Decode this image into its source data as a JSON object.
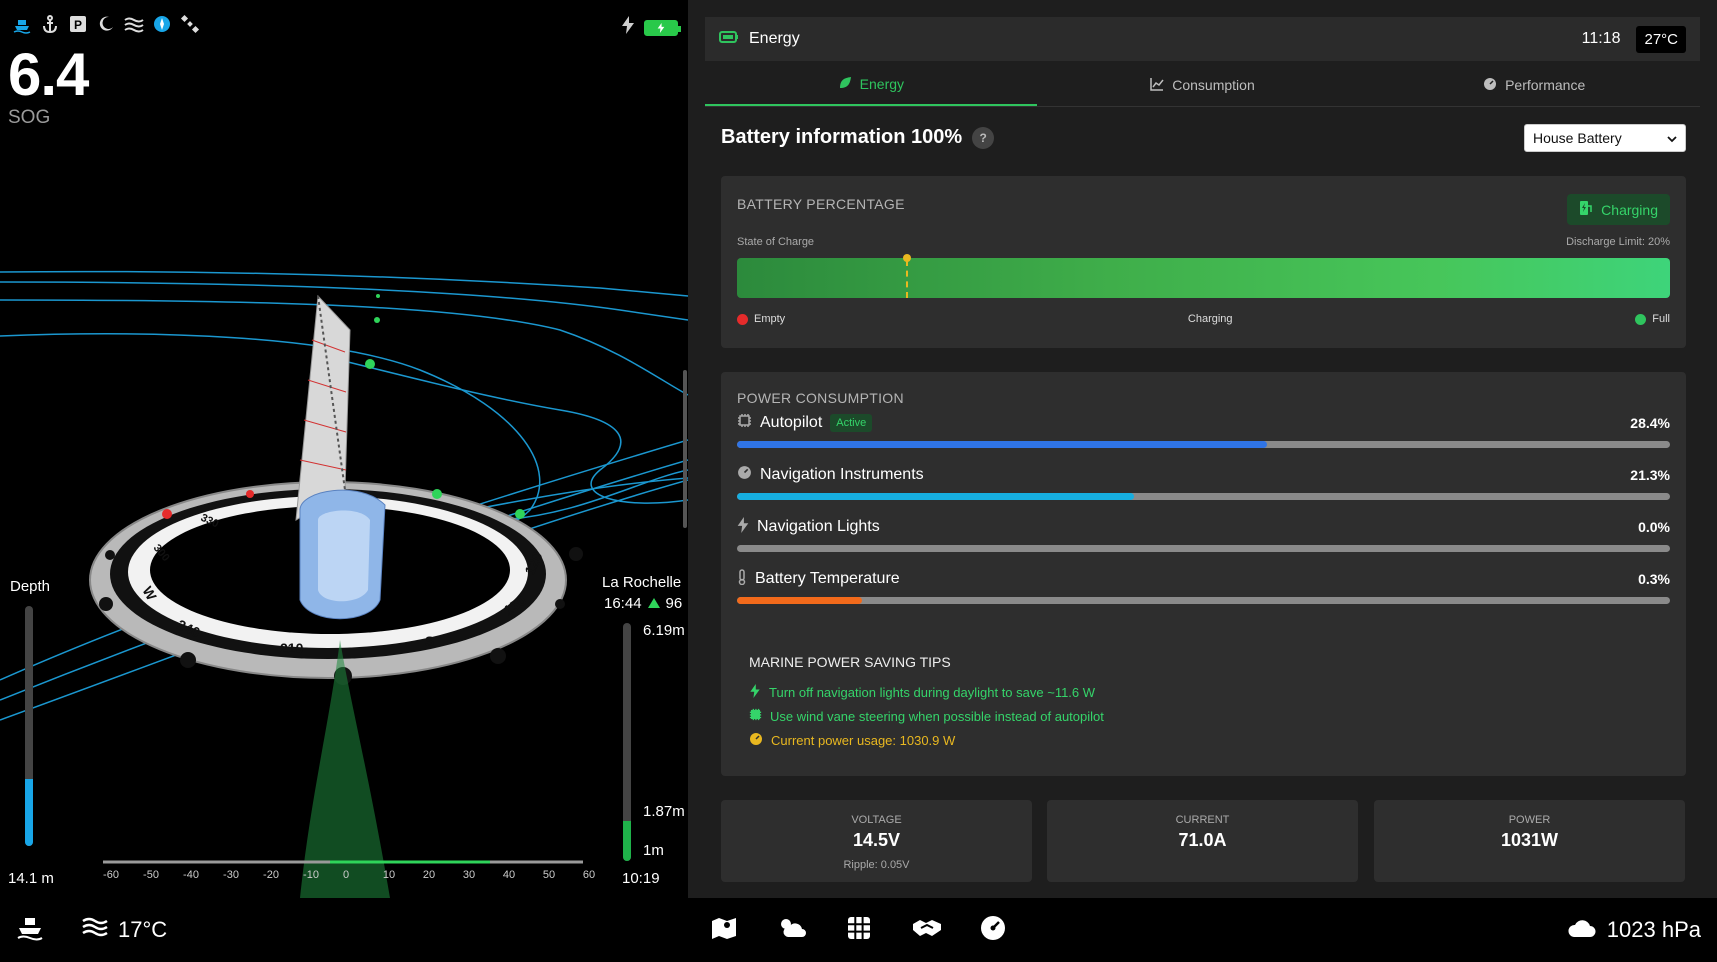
{
  "status_bar": {
    "icons": [
      "boat-icon",
      "anchor-icon",
      "parking-icon",
      "moon-icon",
      "waves-icon",
      "compass-icon",
      "satellite-icon"
    ],
    "charge_icon": "bolt-icon",
    "battery_icon": "battery-full-icon"
  },
  "sog": {
    "value": "6.4",
    "label": "SOG"
  },
  "depth": {
    "label": "Depth",
    "value": "14.1 m"
  },
  "tide": {
    "place": "La Rochelle",
    "time": "16:44",
    "coefficient": "96",
    "high": "6.19m",
    "mid": "1.87m",
    "low": "1m",
    "clock": "10:19"
  },
  "compass": {
    "labels": [
      "W",
      "300",
      "330",
      "240",
      "210",
      "S",
      "150",
      "120"
    ],
    "scale": [
      "-60",
      "-50",
      "-40",
      "-30",
      "-20",
      "-10",
      "0",
      "10",
      "20",
      "30",
      "40",
      "50",
      "60"
    ]
  },
  "header": {
    "title": "Energy",
    "time": "11:18",
    "temperature": "27°C"
  },
  "tabs": [
    {
      "label": "Energy",
      "icon": "leaf-icon"
    },
    {
      "label": "Consumption",
      "icon": "chart-line-icon"
    },
    {
      "label": "Performance",
      "icon": "gauge-icon"
    }
  ],
  "battery_info": {
    "title": "Battery information 100%",
    "help": "?",
    "selected_battery": "House Battery"
  },
  "battery_percentage": {
    "title": "BATTERY PERCENTAGE",
    "status_button": "Charging",
    "soc_label": "State of Charge",
    "discharge_label": "Discharge Limit: 20%",
    "soc_value": 1.0,
    "discharge_limit": 0.2,
    "legend": {
      "empty": "Empty",
      "charging": "Charging",
      "full": "Full"
    }
  },
  "power_consumption": {
    "title": "POWER CONSUMPTION",
    "items": [
      {
        "label": "Autopilot",
        "badge": "Active",
        "percent": "28.4%",
        "fill": 0.568,
        "color": "#2f74e6",
        "icon": "chip-icon"
      },
      {
        "label": "Navigation Instruments",
        "percent": "21.3%",
        "fill": 0.426,
        "color": "#16aee0",
        "icon": "gauge-icon"
      },
      {
        "label": "Navigation Lights",
        "percent": "0.0%",
        "fill": 0.0,
        "color": "#e9b820",
        "icon": "bolt-icon"
      },
      {
        "label": "Battery Temperature",
        "percent": "0.3%",
        "fill": 0.134,
        "color": "#f26a1b",
        "icon": "thermometer-icon"
      }
    ]
  },
  "tips": {
    "title": "MARINE POWER SAVING TIPS",
    "items": [
      {
        "text": "Turn off navigation lights during daylight to save ~11.6 W",
        "color": "#35d46a",
        "icon": "bolt-icon"
      },
      {
        "text": "Use wind vane steering when possible instead of autopilot",
        "color": "#35d46a",
        "icon": "chip-icon"
      },
      {
        "text": "Current power usage: 1030.9 W",
        "color": "#e9b820",
        "icon": "gauge-icon"
      }
    ]
  },
  "stats": {
    "voltage": {
      "label": "VOLTAGE",
      "value": "14.5V",
      "sub": "Ripple: 0.05V"
    },
    "current": {
      "label": "CURRENT",
      "value": "71.0A"
    },
    "power": {
      "label": "POWER",
      "value": "1031W"
    }
  },
  "bottom_bar": {
    "water_temp": "17°C",
    "nav_icons": [
      "map-icon",
      "weather-icon",
      "grid-icon",
      "handshake-icon",
      "gauge-icon"
    ],
    "pressure": "1023 hPa"
  },
  "colors": {
    "accent_green": "#2fc45e",
    "accent_blue": "#18a6e8",
    "warning_yellow": "#e9b820",
    "panel": "#2e2e2e"
  }
}
